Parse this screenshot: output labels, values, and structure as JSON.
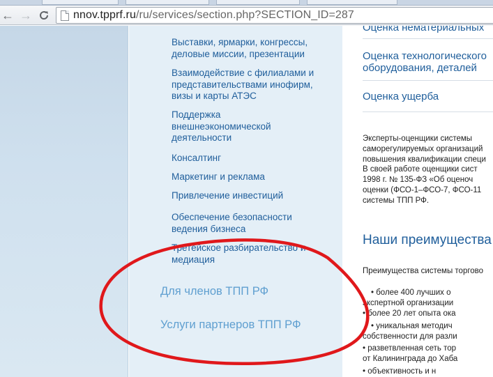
{
  "browser": {
    "url_host": "nnov.tpprf.ru",
    "url_path": "/ru/services/section.php?SECTION_ID=287"
  },
  "sidebar": {
    "sub_items": [
      {
        "label": "Выставки, ярмарки, конгрессы, деловые миссии, презентации"
      },
      {
        "label": "Взаимодействие с филиалами и представительствами инофирм, визы и карты АТЭС"
      },
      {
        "label": "Поддержка внешнеэкономической деятельности"
      },
      {
        "label": "Консалтинг"
      },
      {
        "label": "Маркетинг и реклама"
      },
      {
        "label": "Привлечение инвестиций"
      },
      {
        "label": "Обеспечение безопасности ведения бизнеса"
      },
      {
        "label": "Третейское разбирательство и медиация"
      }
    ],
    "sections": [
      {
        "label": "Для членов ТПП РФ"
      },
      {
        "label": "Услуги партнеров ТПП РФ"
      }
    ]
  },
  "main": {
    "services": [
      {
        "line1": "Оценка нематериальных",
        "line2": ""
      },
      {
        "line1": "Оценка технологического",
        "line2": "оборудования, деталей"
      },
      {
        "line1": "Оценка ущерба",
        "line2": ""
      }
    ],
    "intro_lines": [
      "Эксперты-оценщики системы",
      "саморегулируемых организаций",
      "повышения квалификации специ",
      "В своей работе оценщики сист",
      "1998 г. № 135-ФЗ «Об оценоч",
      "оценки (ФСО-1–ФСО-7, ФСО-11",
      "системы ТПП РФ."
    ],
    "advantages_heading": "Наши преимущества",
    "advantages_intro": "Преимущества системы торгово",
    "bullets": [
      {
        "text": "• более 400 лучших о",
        "cont": "экспертной организации"
      },
      {
        "text": "• более 20 лет опыта ока",
        "cont": ""
      },
      {
        "text": "• уникальная методич",
        "cont": "собственности для разли"
      },
      {
        "text": "• разветвленная сеть тор",
        "cont": "от Калининграда до Хаба"
      },
      {
        "text": "• объективность и н",
        "cont": ""
      }
    ]
  },
  "colors": {
    "link": "#1f5e9b",
    "section_link": "#5f9fd0",
    "sidebar_bg": "#e4eff7",
    "annotation": "#e0181b"
  }
}
